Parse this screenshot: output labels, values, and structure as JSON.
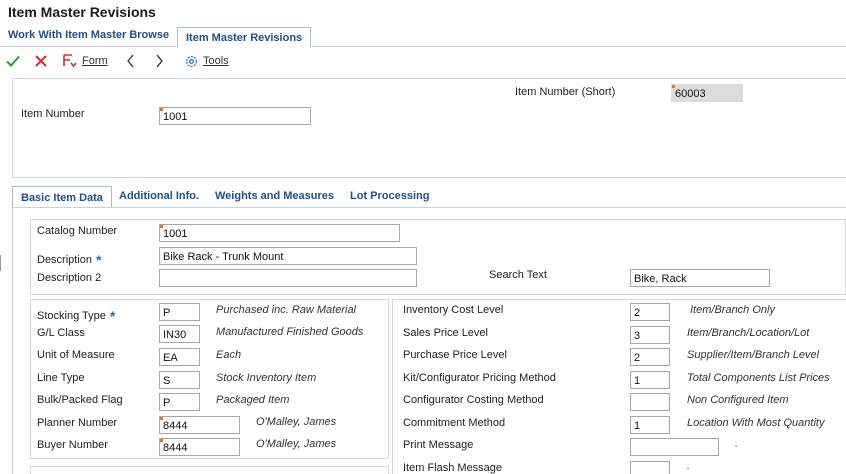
{
  "app": {
    "title": "Item Master Revisions"
  },
  "top_tabs": [
    {
      "label": "Work With Item Master Browse",
      "active": false
    },
    {
      "label": "Item Master Revisions",
      "active": true
    }
  ],
  "toolbar": {
    "ok_icon": "checkmark-icon",
    "cancel_icon": "x-icon",
    "form_icon": "form-menu-icon",
    "form_label": "Form",
    "prev_icon": "chevron-left-icon",
    "next_icon": "chevron-right-icon",
    "tools_icon": "gear-icon",
    "tools_label": "Tools"
  },
  "header": {
    "item_number_short_label": "Item Number (Short)",
    "item_number_short_value": "60003",
    "item_number_label": "Item Number",
    "item_number_value": "1001"
  },
  "detail_tabs": [
    {
      "label": "Basic Item Data",
      "active": true
    },
    {
      "label": "Additional Info.",
      "active": false
    },
    {
      "label": "Weights and Measures",
      "active": false
    },
    {
      "label": "Lot Processing",
      "active": false
    }
  ],
  "basic": {
    "catalog_number_label": "Catalog Number",
    "catalog_number_value": "1001",
    "description_label": "Description",
    "description_value": "Bike Rack - Trunk Mount",
    "required_mark": "*",
    "description2_label": "Description 2",
    "description2_value": "",
    "search_text_label": "Search Text",
    "search_text_value": "Bike, Rack"
  },
  "left_fields": [
    {
      "label": "Stocking Type",
      "required": true,
      "value": "P",
      "desc": "Purchased inc. Raw Material"
    },
    {
      "label": "G/L Class",
      "required": false,
      "value": "IN30",
      "desc": "Manufactured Finished Goods"
    },
    {
      "label": "Unit of Measure",
      "required": false,
      "value": "EA",
      "desc": "Each"
    },
    {
      "label": "Line Type",
      "required": false,
      "value": "S",
      "desc": "Stock Inventory Item"
    },
    {
      "label": "Bulk/Packed Flag",
      "required": false,
      "value": "P",
      "desc": "Packaged Item"
    },
    {
      "label": "Planner Number",
      "required": false,
      "value": "8444",
      "desc": "O'Malley, James"
    },
    {
      "label": "Buyer Number",
      "required": false,
      "value": "8444",
      "desc": "O'Malley, James"
    }
  ],
  "right_fields": [
    {
      "label": "Inventory Cost Level",
      "value": "2",
      "desc": "Item/Branch Only"
    },
    {
      "label": "Sales Price Level",
      "value": "3",
      "desc": "Item/Branch/Location/Lot"
    },
    {
      "label": "Purchase Price Level",
      "value": "2",
      "desc": "Supplier/Item/Branch Level"
    },
    {
      "label": "Kit/Configurator Pricing Method",
      "value": "1",
      "desc": "Total Components List Prices"
    },
    {
      "label": "Configurator Costing Method",
      "value": "",
      "desc": "Non Configured Item"
    },
    {
      "label": "Commitment Method",
      "value": "1",
      "desc": "Location With Most Quantity"
    },
    {
      "label": "Print Message",
      "value": "",
      "desc": "."
    },
    {
      "label": "Item Flash Message",
      "value": "",
      "desc": "."
    }
  ]
}
